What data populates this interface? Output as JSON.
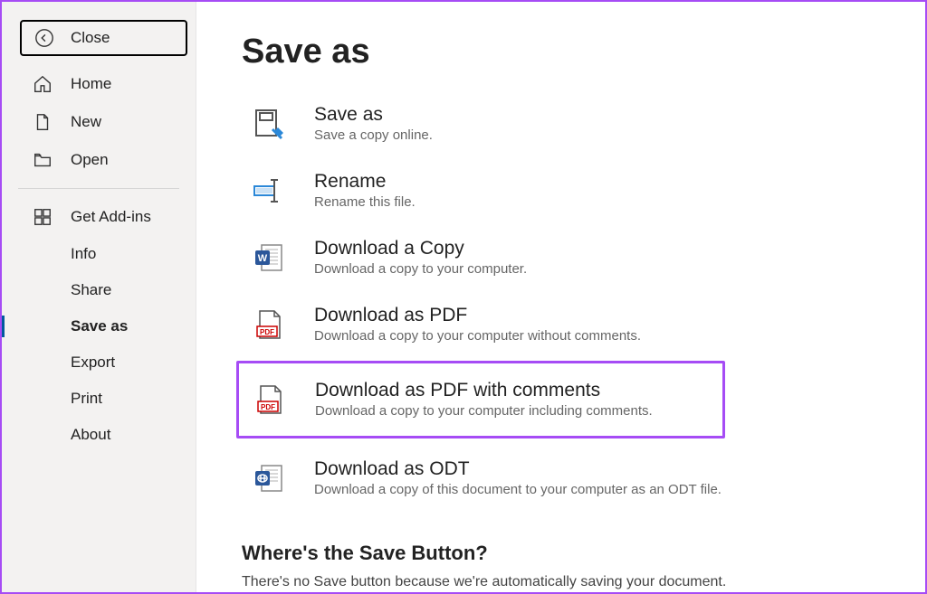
{
  "sidebar": {
    "close_label": "Close",
    "items": [
      {
        "label": "Home"
      },
      {
        "label": "New"
      },
      {
        "label": "Open"
      }
    ],
    "sub_items": [
      {
        "label": "Get Add-ins"
      },
      {
        "label": "Info"
      },
      {
        "label": "Share"
      },
      {
        "label": "Save as"
      },
      {
        "label": "Export"
      },
      {
        "label": "Print"
      },
      {
        "label": "About"
      }
    ]
  },
  "main": {
    "title": "Save as",
    "options": [
      {
        "title": "Save as",
        "desc": "Save a copy online."
      },
      {
        "title": "Rename",
        "desc": "Rename this file."
      },
      {
        "title": "Download a Copy",
        "desc": "Download a copy to your computer."
      },
      {
        "title": "Download as PDF",
        "desc": "Download a copy to your computer without comments."
      },
      {
        "title": "Download as PDF with comments",
        "desc": "Download a copy to your computer including comments."
      },
      {
        "title": "Download as ODT",
        "desc": "Download a copy of this document to your computer as an ODT file."
      }
    ],
    "help": {
      "title": "Where's the Save Button?",
      "text": "There's no Save button because we're automatically saving your document."
    }
  }
}
